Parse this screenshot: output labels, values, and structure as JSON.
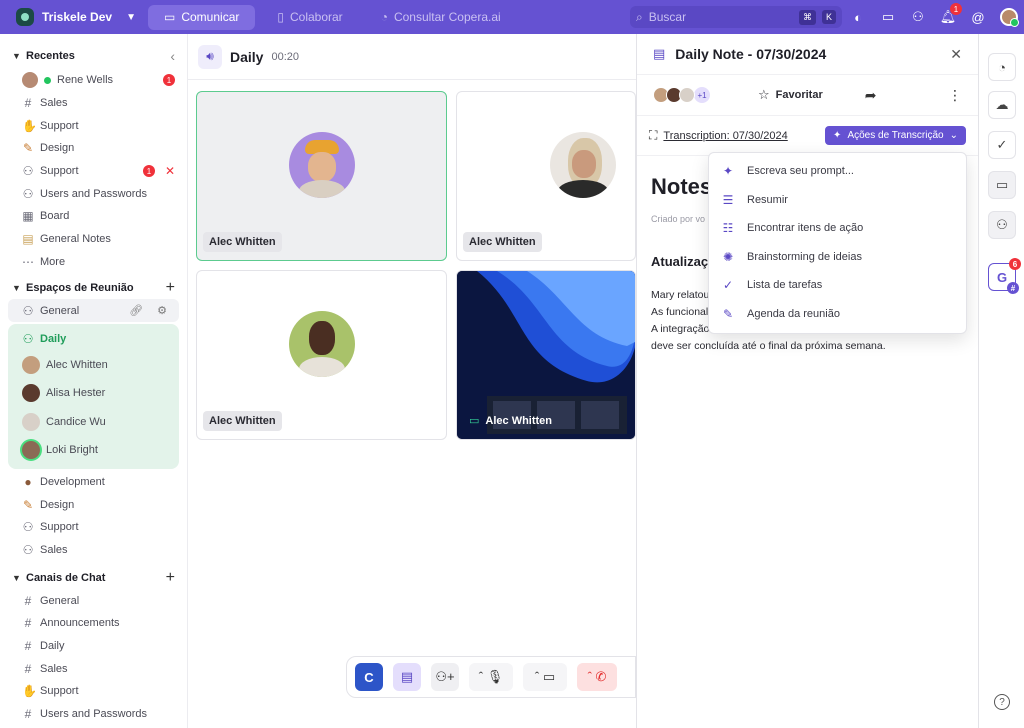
{
  "workspace": {
    "name": "Triskele Dev"
  },
  "nav": {
    "tabs": [
      {
        "label": "Comunicar"
      },
      {
        "label": "Colaborar"
      },
      {
        "label": "Consultar Copera.ai"
      }
    ]
  },
  "search": {
    "placeholder": "Buscar",
    "kbd1": "⌘",
    "kbd2": "K"
  },
  "topbar": {
    "notif_count": "1"
  },
  "sidebar": {
    "recentes": {
      "title": "Recentes",
      "items": [
        {
          "label": "Rene Wells",
          "badge": "1"
        },
        {
          "label": "Sales"
        },
        {
          "label": "Support"
        },
        {
          "label": "Design"
        },
        {
          "label": "Support",
          "badge": "1"
        },
        {
          "label": "Users and Passwords"
        },
        {
          "label": "Board"
        },
        {
          "label": "General Notes"
        },
        {
          "label": "More"
        }
      ]
    },
    "espacos": {
      "title": "Espaços de Reunião",
      "general": "General",
      "daily": "Daily",
      "participants": [
        "Alec Whitten",
        "Alisa Hester",
        "Candice Wu",
        "Loki Bright"
      ],
      "items": [
        "Development",
        "Design",
        "Support",
        "Sales"
      ]
    },
    "canais": {
      "title": "Canais de Chat",
      "items": [
        "General",
        "Announcements",
        "Daily",
        "Sales",
        "Support",
        "Users and Passwords"
      ]
    }
  },
  "main": {
    "room": "Daily",
    "timer": "00:20",
    "tiles": [
      "Alec Whitten",
      "Alec Whitten",
      "Alec Whitten",
      "Alec Whitten"
    ]
  },
  "note": {
    "title": "Daily Note - 07/30/2024",
    "stack_more": "+1",
    "favorite": "Favoritar",
    "transcription": "Transcription: 07/30/2024",
    "actions": "Ações de Transcrição",
    "heading": "Notes",
    "meta": "Criado por vo",
    "section": "Atualizaç",
    "p1": "Mary relatou",
    "p2": "As funcional",
    "p3": "A integração do sistema de pagamento está em andamento e",
    "p4": "deve ser concluída até o final da próxima semana."
  },
  "menu": {
    "items": [
      {
        "label": "Escreva seu prompt...",
        "icon": "sparkle-icon"
      },
      {
        "label": "Resumir",
        "icon": "list-icon"
      },
      {
        "label": "Encontrar itens de ação",
        "icon": "checklist-icon"
      },
      {
        "label": "Brainstorming de ideias",
        "icon": "bulb-icon"
      },
      {
        "label": "Lista de tarefas",
        "icon": "check-circle-icon"
      },
      {
        "label": "Agenda da reunião",
        "icon": "pen-icon"
      }
    ]
  },
  "rail": {
    "g_badge": "6",
    "g_label": "G"
  },
  "colors": {
    "accent": "#6552d2",
    "green": "#22c55e",
    "red": "#f0313a"
  }
}
